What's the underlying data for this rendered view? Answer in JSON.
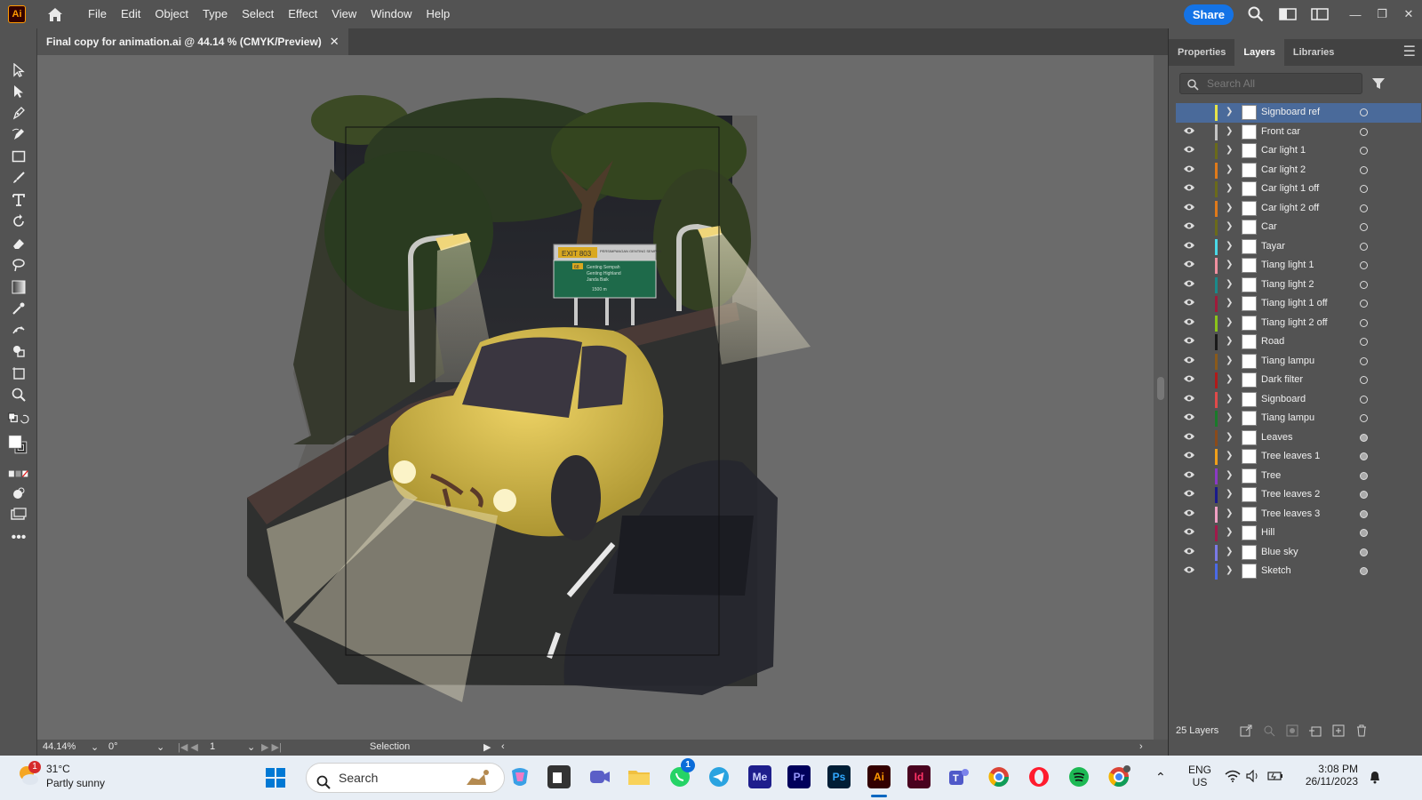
{
  "app": {
    "logo_text": "Ai"
  },
  "menu": [
    "File",
    "Edit",
    "Object",
    "Type",
    "Select",
    "Effect",
    "View",
    "Window",
    "Help"
  ],
  "share_label": "Share",
  "document_tab": {
    "title": "Final copy for animation.ai @ 44.14 % (CMYK/Preview)",
    "close": "✕"
  },
  "artwork": {
    "sign_exit": "EXIT 803",
    "sign_top": "PERSIMPANGAN GENTING SEMPAH",
    "sign_lines": [
      "Genting Sempah",
      "Genting Highland",
      "Janda Baik",
      "1500 m"
    ],
    "sign_route": "68"
  },
  "status": {
    "zoom": "44.14%",
    "rotation": "0°",
    "artboard": "1",
    "tool": "Selection"
  },
  "panel": {
    "tabs": [
      "Properties",
      "Layers",
      "Libraries"
    ],
    "active_tab": "Layers",
    "search_placeholder": "Search All",
    "layer_count_label": "25 Layers",
    "layers": [
      {
        "name": "Signboard ref",
        "color": "#e6e34a",
        "visible": false,
        "selected": true
      },
      {
        "name": "Front car",
        "color": "#c4c4c4",
        "visible": true
      },
      {
        "name": "Car light 1",
        "color": "#6b6b1a",
        "visible": true
      },
      {
        "name": "Car light 2",
        "color": "#e07a1a",
        "visible": true
      },
      {
        "name": "Car light 1 off",
        "color": "#6b6b1a",
        "visible": true
      },
      {
        "name": "Car light 2 off",
        "color": "#e07a1a",
        "visible": true
      },
      {
        "name": "Car",
        "color": "#6b6b1a",
        "visible": true
      },
      {
        "name": "Tayar",
        "color": "#4ad8e6",
        "visible": true
      },
      {
        "name": "Tiang light 1",
        "color": "#f090a0",
        "visible": true
      },
      {
        "name": "Tiang light 2",
        "color": "#1a8a8a",
        "visible": true
      },
      {
        "name": "Tiang light 1 off",
        "color": "#a01a3a",
        "visible": true
      },
      {
        "name": "Tiang light 2 off",
        "color": "#8ac41a",
        "visible": true
      },
      {
        "name": "Road",
        "color": "#1a1a1a",
        "visible": true
      },
      {
        "name": "Tiang lampu",
        "color": "#8a5a1a",
        "visible": true
      },
      {
        "name": "Dark filter",
        "color": "#b01a1a",
        "visible": true
      },
      {
        "name": "Signboard",
        "color": "#e04a4a",
        "visible": true
      },
      {
        "name": "Tiang lampu",
        "color": "#1a7a2a",
        "visible": true
      },
      {
        "name": "Leaves",
        "color": "#8a4a1a",
        "visible": true
      },
      {
        "name": "Tree leaves 1",
        "color": "#f0a01a",
        "visible": true
      },
      {
        "name": "Tree",
        "color": "#8a3ac4",
        "visible": true
      },
      {
        "name": "Tree leaves 2",
        "color": "#1a1a8a",
        "visible": true
      },
      {
        "name": "Tree leaves 3",
        "color": "#f0a0c4",
        "visible": true
      },
      {
        "name": "Hill",
        "color": "#a01a4a",
        "visible": true
      },
      {
        "name": "Blue sky",
        "color": "#7a7ae6",
        "visible": true
      },
      {
        "name": "Sketch",
        "color": "#4a6ae6",
        "visible": true
      }
    ]
  },
  "taskbar": {
    "weather_temp": "31°C",
    "weather_cond": "Partly sunny",
    "weather_badge": "1",
    "search_label": "Search",
    "whatsapp_badge": "1",
    "language_1": "ENG",
    "language_2": "US",
    "time": "3:08 PM",
    "date": "26/11/2023",
    "apps": [
      "Me",
      "Pr",
      "Ps",
      "Ai",
      "Id"
    ]
  }
}
